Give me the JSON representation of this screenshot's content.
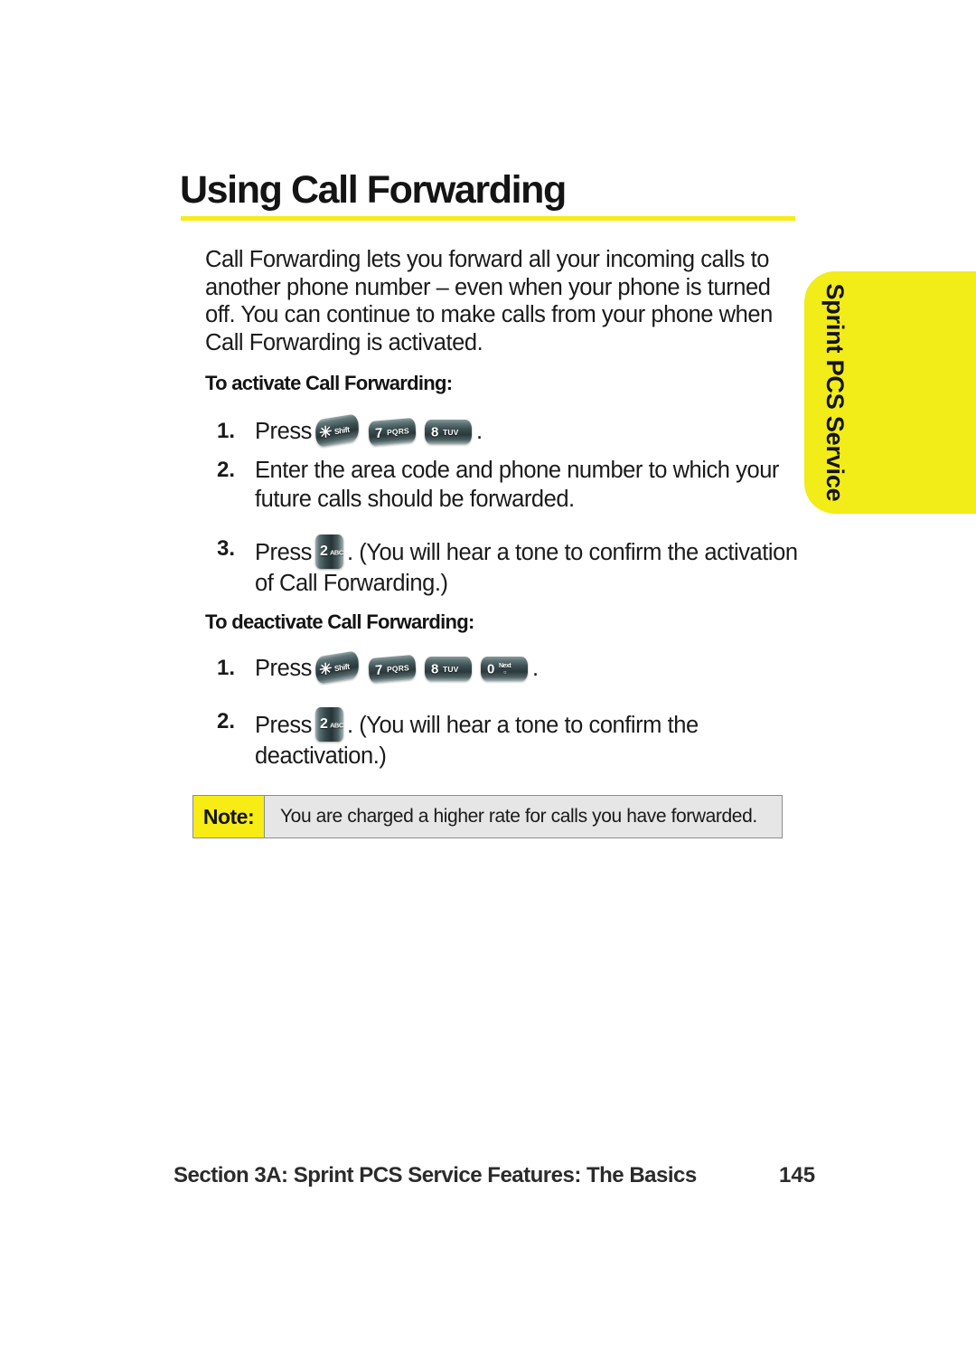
{
  "page": {
    "title": "Using Call Forwarding",
    "intro": "Call Forwarding lets you forward all your incoming calls to another phone number – even when your phone is turned off. You can continue to make calls from your phone when Call Forwarding is activated.",
    "accent_color": "#f7ec14",
    "rule_color": "#f7ec14"
  },
  "side_tab": {
    "label": "Sprint PCS Service",
    "background_color": "#f2ec18",
    "text_color": "#141414"
  },
  "sections": {
    "activate": {
      "heading": "To activate Call Forwarding:",
      "steps": [
        {
          "number": "1.",
          "text_before": "Press",
          "text_after": ".",
          "keys": [
            "shift-star-key",
            "7-pqrs-key",
            "8-tuv-key"
          ]
        },
        {
          "number": "2.",
          "text_before": "Enter the area code and phone number to which your future calls should be forwarded.",
          "text_after": "",
          "keys": []
        },
        {
          "number": "3.",
          "text_before": "Press",
          "text_after": ". (You will hear a tone to confirm the activation of Call Forwarding.)",
          "keys": [
            "2-abc-key"
          ]
        }
      ]
    },
    "deactivate": {
      "heading": "To deactivate Call Forwarding:",
      "steps": [
        {
          "number": "1.",
          "text_before": "Press",
          "text_after": ".",
          "keys": [
            "shift-star-key",
            "7-pqrs-key",
            "8-tuv-key",
            "0-next-key"
          ]
        },
        {
          "number": "2.",
          "text_before": "Press",
          "text_after": ". (You will hear a tone to confirm the deactivation.)",
          "keys": [
            "2-abc-key"
          ]
        }
      ]
    }
  },
  "keys": {
    "shift": {
      "glyph": "✳",
      "label": "Shift"
    },
    "seven": {
      "digit": "7",
      "label": "PQRS"
    },
    "eight": {
      "digit": "8",
      "label": "TUV"
    },
    "zero": {
      "digit": "0",
      "label_top": "Next",
      "label_bottom": "▫"
    },
    "two": {
      "digit": "2",
      "label": "ABC"
    }
  },
  "note": {
    "label": "Note:",
    "text": "You are charged a higher rate for calls you have forwarded.",
    "label_background": "#f7ec14",
    "body_background": "#e6e6e6"
  },
  "footer": {
    "section": "Section 3A: Sprint PCS Service Features: The Basics",
    "page_number": "145"
  }
}
